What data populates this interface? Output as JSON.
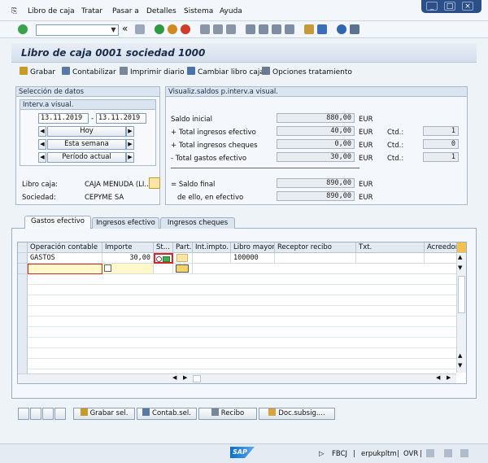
{
  "menu": {
    "items": [
      "Libro de caja",
      "Tratar",
      "Pasar a",
      "Detalles",
      "Sistema",
      "Ayuda"
    ]
  },
  "window_controls": [
    "_",
    "□",
    "×"
  ],
  "toolbar": {
    "command_value": "",
    "collapse_symbol": "«"
  },
  "title": "Libro de caja 0001  sociedad 1000",
  "app_toolbar": [
    "Grabar",
    "Contabilizar",
    "Imprimir diario",
    "Cambiar libro caja",
    "Opciones tratamiento"
  ],
  "selection": {
    "header": "Selección de datos",
    "interval_header": "Interv.a visual.",
    "date_from": "13.11.2019",
    "date_sep": "-",
    "date_to": "13.11.2019",
    "nav_buttons": [
      "Hoy",
      "Esta semana",
      "Período actual"
    ],
    "libro_caja_label": "Libro caja:",
    "libro_caja_value": "CAJA MENUDA (LI...",
    "sociedad_label": "Sociedad:",
    "sociedad_value": "CEPYME SA"
  },
  "balances": {
    "header": "Visualiz.saldos p.interv.a visual.",
    "currency": "EUR",
    "ctd_label": "Ctd.:",
    "rows": [
      {
        "label": "Saldo inicial",
        "value": "880,00",
        "ctd": ""
      },
      {
        "label": "+ Total ingresos efectivo",
        "value": "40,00",
        "ctd": "1"
      },
      {
        "label": "+ Total ingresos cheques",
        "value": "0,00",
        "ctd": "0"
      },
      {
        "label": "- Total gastos efectivo",
        "value": "30,00",
        "ctd": "1"
      }
    ],
    "final_label": "= Saldo final",
    "final_value": "890,00",
    "cash_label": "de ello, en efectivo",
    "cash_value": "890,00"
  },
  "tabs": [
    "Gastos efectivo",
    "Ingresos efectivo",
    "Ingresos cheques"
  ],
  "table": {
    "columns": [
      "Operación contable",
      "Importe",
      "St...",
      "Part.",
      "Int.impto.",
      "Libro mayor",
      "Receptor recibo",
      "Txt.",
      "Acreedor"
    ],
    "rows": [
      {
        "operacion": "GASTOS",
        "importe": "30,00",
        "libro_mayor": "100000"
      }
    ]
  },
  "bottom_buttons": [
    "Grabar sel.",
    "Contab.sel.",
    "Recibo",
    "Doc.subsig...."
  ],
  "status": {
    "sap": "SAP",
    "transaction": "FBCJ",
    "system": "erpukpltm",
    "mode": "OVR"
  }
}
